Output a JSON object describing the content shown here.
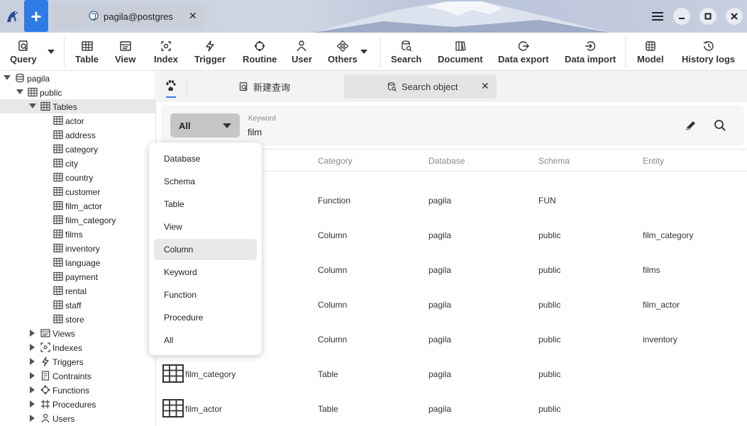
{
  "titlebar": {
    "connection_tab": "pagila@postgres",
    "close_symbol": "✕",
    "new_symbol": "+"
  },
  "toolbar": {
    "items": [
      {
        "label": "Query",
        "icon": "query-icon"
      },
      {
        "label": "Table",
        "icon": "table-icon"
      },
      {
        "label": "View",
        "icon": "view-icon"
      },
      {
        "label": "Index",
        "icon": "index-icon"
      },
      {
        "label": "Trigger",
        "icon": "trigger-icon"
      },
      {
        "label": "Routine",
        "icon": "routine-icon"
      },
      {
        "label": "User",
        "icon": "user-icon"
      },
      {
        "label": "Others",
        "icon": "others-icon"
      },
      {
        "label": "Search",
        "icon": "search-db-icon"
      },
      {
        "label": "Document",
        "icon": "document-icon"
      },
      {
        "label": "Data export",
        "icon": "export-icon"
      },
      {
        "label": "Data import",
        "icon": "import-icon"
      },
      {
        "label": "Model",
        "icon": "model-icon"
      },
      {
        "label": "History logs",
        "icon": "history-icon"
      }
    ]
  },
  "sidebar": {
    "database": "pagila",
    "schema": "public",
    "tables_folder": "Tables",
    "tables": [
      "actor",
      "address",
      "category",
      "city",
      "country",
      "customer",
      "film_actor",
      "film_category",
      "films",
      "inventory",
      "language",
      "payment",
      "rental",
      "staff",
      "store"
    ],
    "folders": [
      "Views",
      "Indexes",
      "Triggers",
      "Contraints",
      "Functions",
      "Procedures",
      "Users"
    ]
  },
  "tabs": {
    "query_tab": "新建查询",
    "search_tab": "Search object",
    "close_symbol": "✕"
  },
  "search": {
    "scope_value": "All",
    "keyword_label": "Keyword",
    "keyword_value": "film"
  },
  "grid": {
    "headers": [
      "Category",
      "Database",
      "Schema",
      "Entity"
    ],
    "rows": [
      {
        "name": "",
        "category": "Function",
        "database": "pagila",
        "schema": "FUN",
        "entity": ""
      },
      {
        "name": "",
        "category": "Column",
        "database": "pagila",
        "schema": "public",
        "entity": "film_category"
      },
      {
        "name": "",
        "category": "Column",
        "database": "pagila",
        "schema": "public",
        "entity": "films"
      },
      {
        "name": "",
        "category": "Column",
        "database": "pagila",
        "schema": "public",
        "entity": "film_actor"
      },
      {
        "name": "",
        "category": "Column",
        "database": "pagila",
        "schema": "public",
        "entity": "inventory"
      },
      {
        "name": "film_category",
        "category": "Table",
        "database": "pagila",
        "schema": "public",
        "entity": ""
      },
      {
        "name": "film_actor",
        "category": "Table",
        "database": "pagila",
        "schema": "public",
        "entity": ""
      }
    ]
  },
  "scope_dropdown": {
    "options": [
      "Database",
      "Schema",
      "Table",
      "View",
      "Column",
      "Keyword",
      "Function",
      "Procedure",
      "All"
    ],
    "highlighted": "Column"
  },
  "colors": {
    "accent": "#2f7be6",
    "selection": "#e8e8e8"
  }
}
